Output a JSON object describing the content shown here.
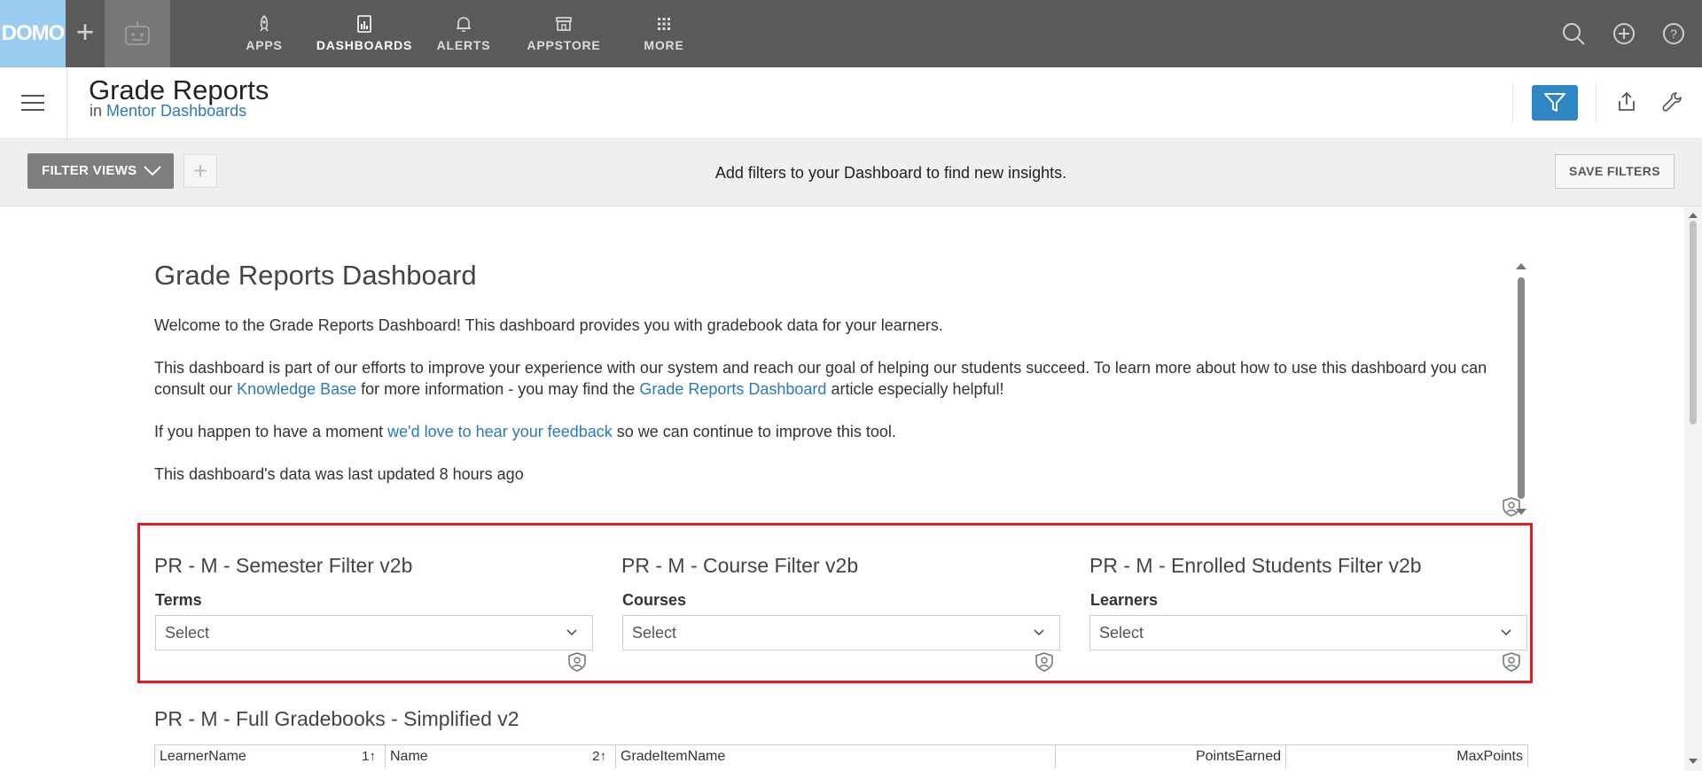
{
  "topbar": {
    "logo": "DOMO",
    "nav": [
      {
        "label": "APPS",
        "icon": "rocket-icon"
      },
      {
        "label": "DASHBOARDS",
        "icon": "dashboard-icon"
      },
      {
        "label": "ALERTS",
        "icon": "bell-icon"
      },
      {
        "label": "APPSTORE",
        "icon": "store-icon"
      },
      {
        "label": "MORE",
        "icon": "grid-icon"
      }
    ],
    "active": "DASHBOARDS",
    "right_icons": [
      "search-icon",
      "add-circle-icon",
      "help-icon"
    ]
  },
  "header": {
    "title": "Grade Reports",
    "in_prefix": "in",
    "location_link": "Mentor Dashboards"
  },
  "filterbar": {
    "filter_views_label": "FILTER VIEWS",
    "message": "Add filters to your Dashboard to find new insights.",
    "save_filters_label": "SAVE FILTERS"
  },
  "intro": {
    "title": "Grade Reports Dashboard",
    "p1": "Welcome  to the Grade Reports Dashboard! This dashboard provides you with gradebook data for your learners.",
    "p2_a": "This dashboard is part of our efforts to improve your experience with our system and reach our goal of helping our students succeed. To learn more about how to use this dashboard you can consult our ",
    "p2_link1": "Knowledge Base",
    "p2_b": " for more information - you may find the ",
    "p2_link2": "Grade Reports Dashboard",
    "p2_c": " article especially helpful!",
    "p3_a": "If you happen to have a moment ",
    "p3_link": "we'd love to hear your feedback",
    "p3_b": " so we can continue to improve this tool.",
    "p4": "This dashboard's data was last updated 8 hours ago"
  },
  "filters": [
    {
      "title": "PR - M - Semester Filter v2b",
      "label": "Terms",
      "value": "Select"
    },
    {
      "title": "PR - M - Course Filter v2b",
      "label": "Courses",
      "value": "Select"
    },
    {
      "title": "PR - M - Enrolled Students Filter v2b",
      "label": "Learners",
      "value": "Select"
    }
  ],
  "table": {
    "title": "PR - M - Full Gradebooks - Simplified v2",
    "columns": [
      "LearnerName",
      "Name",
      "GradeItemName",
      "PointsEarned",
      "MaxPoints"
    ],
    "sort1": "1↑",
    "sort2": "2↑"
  },
  "colors": {
    "accent": "#2f86c4",
    "highlight": "#e01b22",
    "nav_bg": "#5a5a5a"
  }
}
